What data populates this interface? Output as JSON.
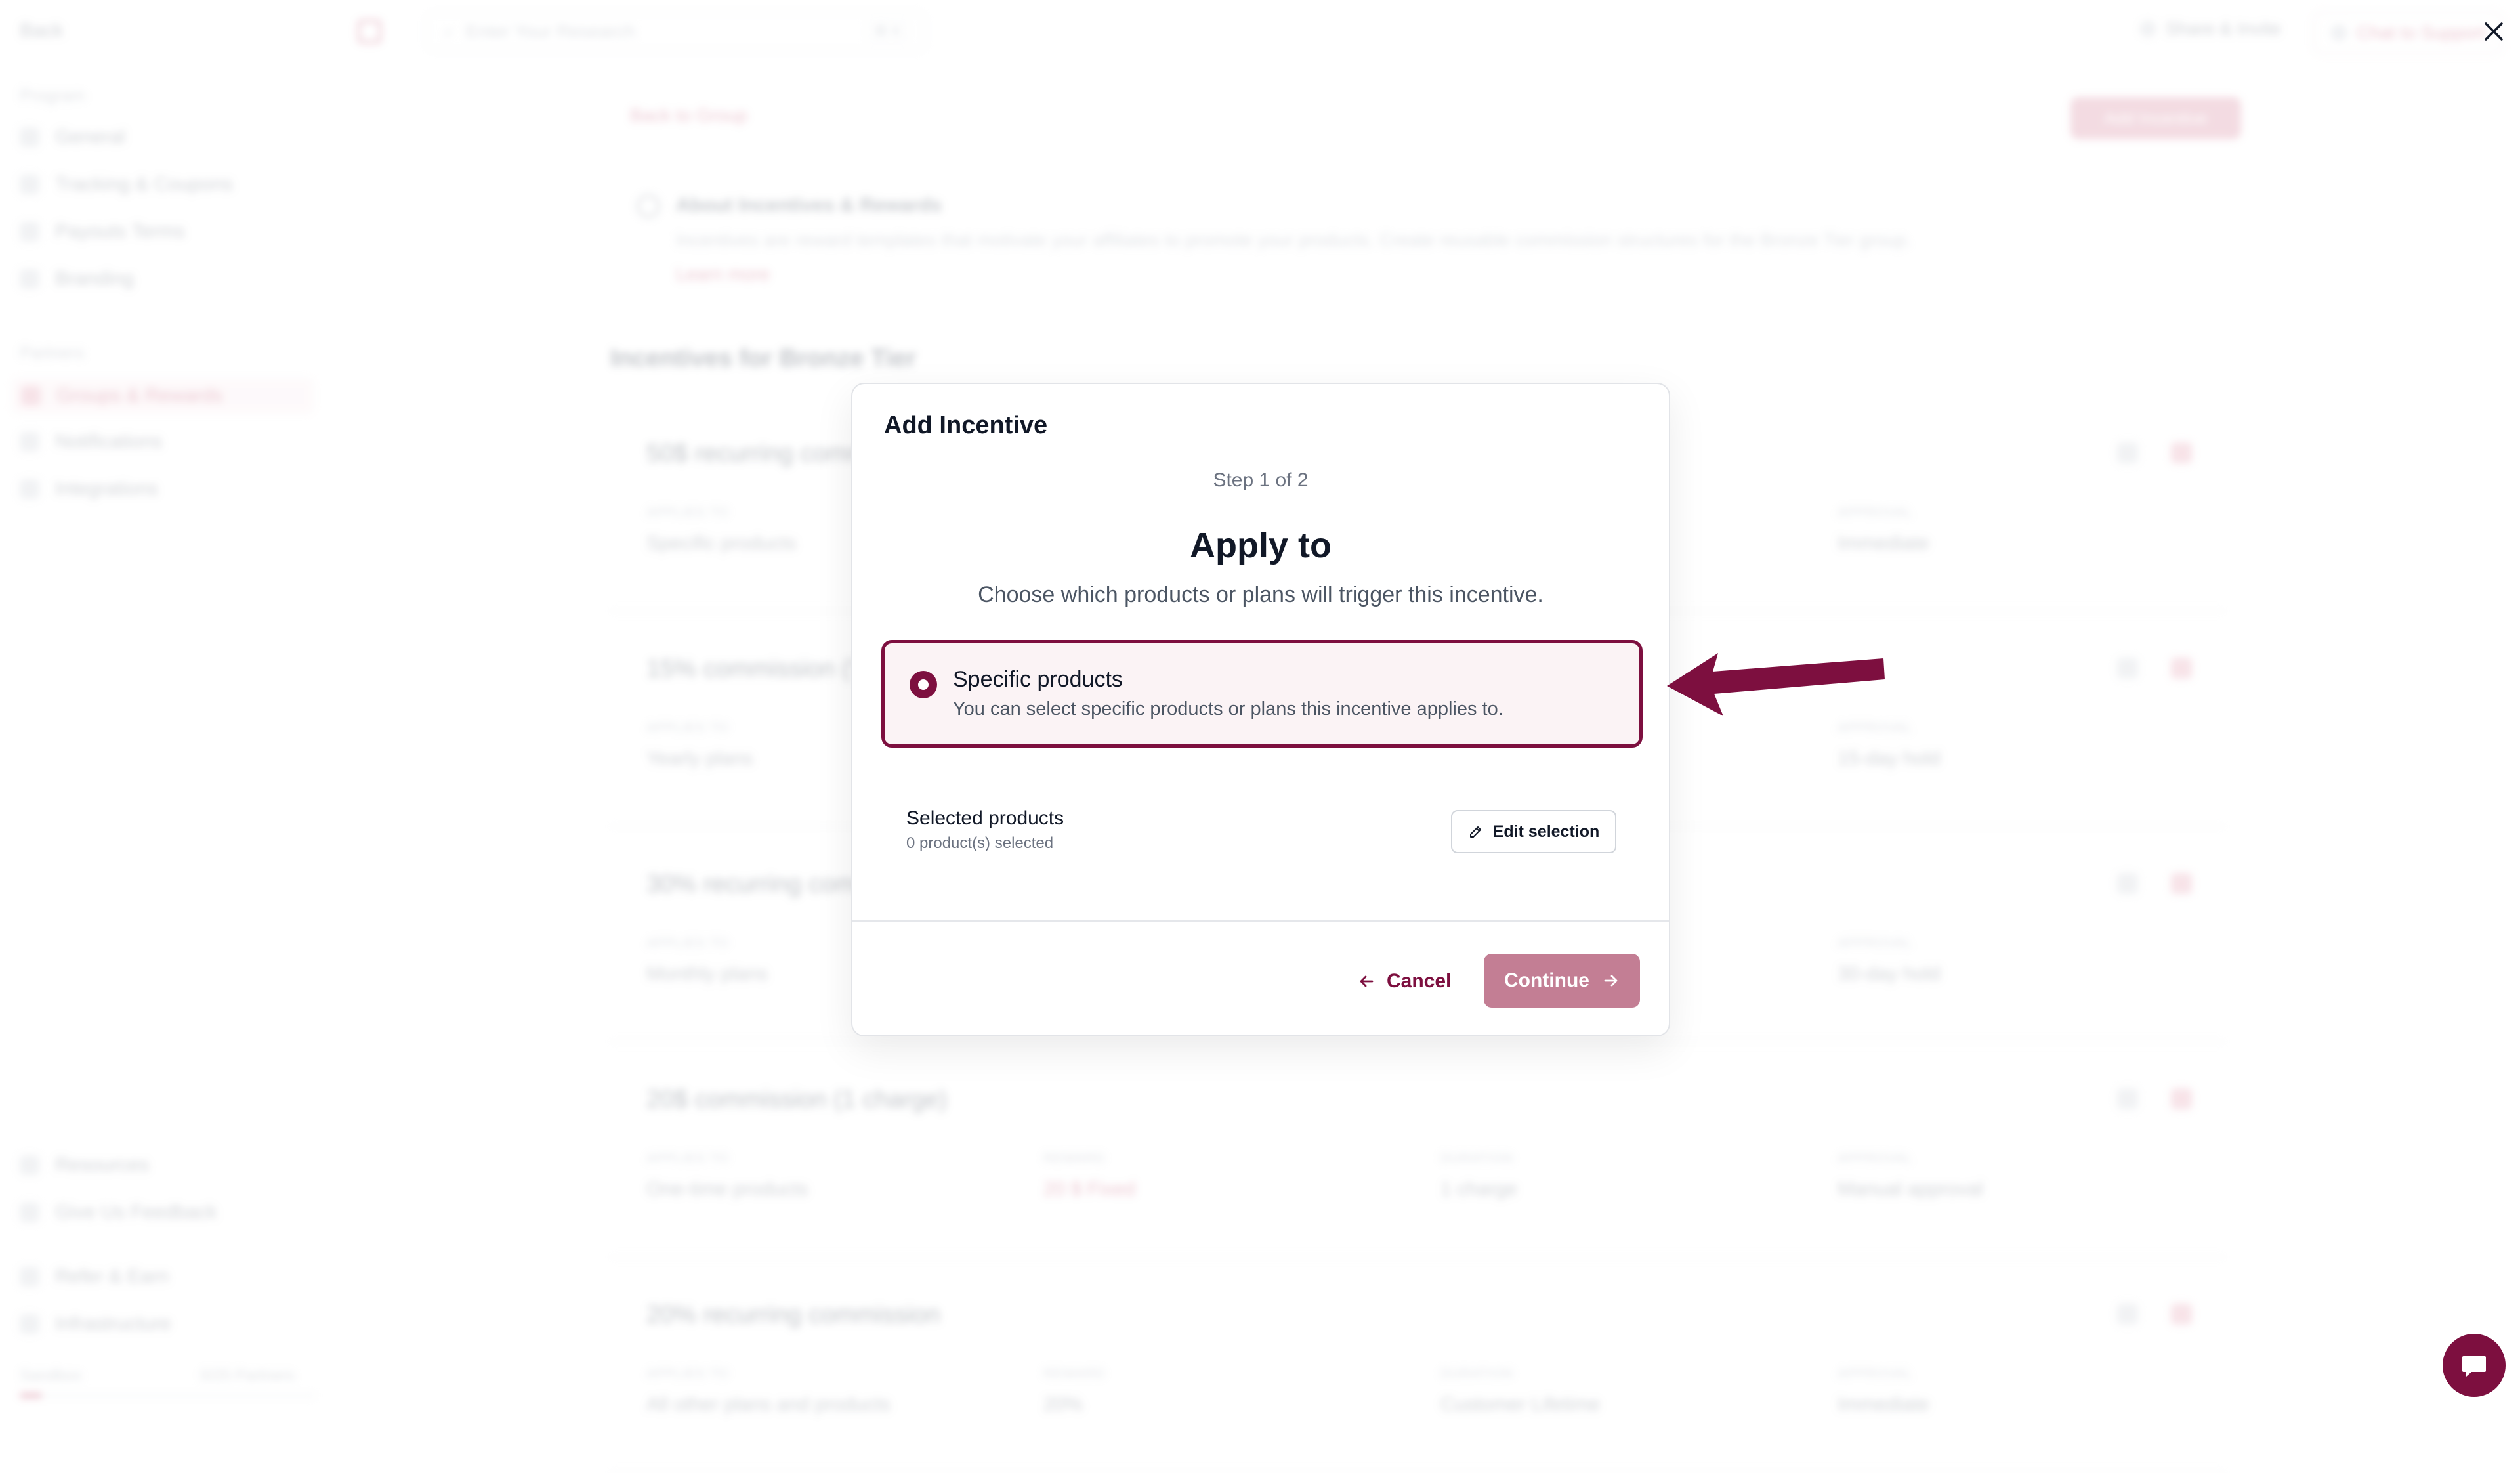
{
  "background": {
    "sidebar": {
      "back": "Back",
      "section_program": "Program",
      "items_program": [
        "General",
        "Tracking & Coupons",
        "Payouts Terms",
        "Branding"
      ],
      "section_partners": "Partners",
      "items_partners": [
        "Groups & Rewards",
        "Notifications",
        "Integrations"
      ],
      "items_bottom": [
        "Resources",
        "Give Us Feedback"
      ],
      "items_footer": [
        "Refer & Earn",
        "Infrastructure"
      ],
      "footer_label": "Sandbox",
      "footer_value": "0/25 Partners"
    },
    "topbar": {
      "search_placeholder": "Enter Your Research",
      "search_kbd": "⌘ K",
      "right_link": "Share & Invite",
      "right_button": "Chat to Support"
    },
    "main": {
      "back_link": "Back to Group",
      "add_button": "Add Incentive",
      "about_title": "About Incentives & Rewards",
      "about_body": "Incentives are reward templates that motivate your affiliates to promote your products. Create reusable commission structures for the Bronze Tier group.",
      "about_link": "Learn more",
      "section_title": "Incentives for Bronze Tier",
      "cards": [
        {
          "title": "50$ recurring commission",
          "cols": [
            {
              "label": "APPLIES TO",
              "value": "Specific products",
              "red": false
            },
            {
              "label": "APPROVAL",
              "value": "Immediate",
              "red": false
            }
          ]
        },
        {
          "title": "15% commission (Yearly plans)",
          "cols": [
            {
              "label": "APPLIES TO",
              "value": "Yearly plans",
              "red": false
            },
            {
              "label": "APPROVAL",
              "value": "15-day hold",
              "red": false
            }
          ]
        },
        {
          "title": "30% recurring commission",
          "cols": [
            {
              "label": "APPLIES TO",
              "value": "Monthly plans",
              "red": false
            },
            {
              "label": "APPROVAL",
              "value": "30-day hold",
              "red": false
            }
          ]
        },
        {
          "title": "20$ commission (1 charge)",
          "cols": [
            {
              "label": "APPLIES TO",
              "value": "One-time products",
              "red": false
            },
            {
              "label": "REWARD",
              "value": "20 $ Fixed",
              "red": true
            },
            {
              "label": "DURATION",
              "value": "1 charge",
              "red": false
            },
            {
              "label": "APPROVAL",
              "value": "Manual approval",
              "red": false
            }
          ]
        },
        {
          "title": "20% recurring commission",
          "cols": [
            {
              "label": "APPLIES TO",
              "value": "All other plans and products",
              "red": false
            },
            {
              "label": "REWARD",
              "value": "20%",
              "red": false
            },
            {
              "label": "DURATION",
              "value": "Customer Lifetime",
              "red": false
            },
            {
              "label": "APPROVAL",
              "value": "Immediate",
              "red": false
            }
          ]
        }
      ]
    }
  },
  "modal": {
    "title": "Add Incentive",
    "step": "Step 1 of 2",
    "heading": "Apply to",
    "subtitle": "Choose which products or plans will trigger this incentive.",
    "option": {
      "title": "Specific products",
      "description": "You can select specific products or plans this incentive applies to."
    },
    "selected": {
      "title": "Selected products",
      "count": "0 product(s) selected",
      "edit_label": "Edit selection"
    },
    "cancel_label": "Cancel",
    "continue_label": "Continue"
  },
  "colors": {
    "accent": "#7d0f3f",
    "continue_disabled": "#c37e94",
    "option_bg": "#fbf3f5"
  },
  "icons": {
    "option": "radio-checked-icon",
    "edit": "pencil-icon",
    "cancel": "arrow-left-icon",
    "continue": "arrow-right-icon",
    "close": "close-icon",
    "chat": "chat-bubble-icon"
  }
}
